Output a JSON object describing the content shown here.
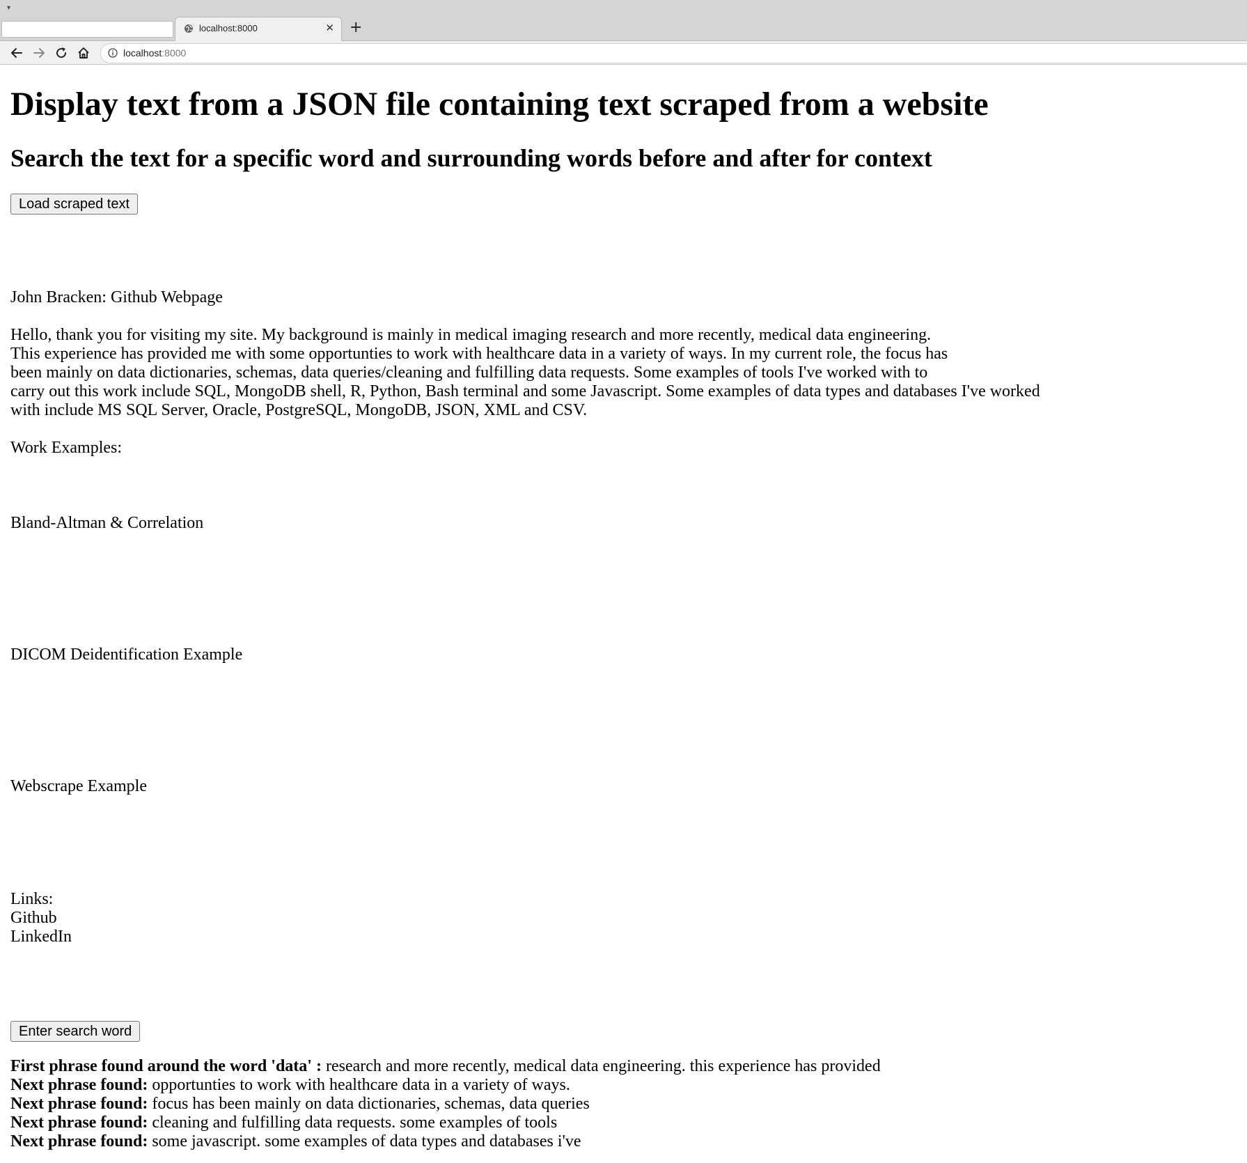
{
  "browser": {
    "tab_title": "localhost:8000",
    "new_tab_symbol": "+",
    "close_symbol": "✕",
    "url_host": "localhost",
    "url_port": ":8000"
  },
  "page": {
    "heading": "Display text from a JSON file containing text scraped from a website",
    "subheading": "Search the text for a specific word and surrounding words before and after for context",
    "load_button": "Load scraped text",
    "scraped": {
      "title": "John Bracken: Github Webpage",
      "intro_lines": [
        "Hello, thank you for visiting my site. My background is mainly in medical imaging research and more recently, medical data engineering.",
        "This experience has provided me with some opportunties to work with healthcare data in a variety of ways. In my current role, the focus has",
        "been mainly on data dictionaries, schemas, data queries/cleaning and fulfilling data requests. Some examples of tools I've worked with to",
        "carry out this work include SQL, MongoDB shell, R, Python, Bash terminal and some Javascript. Some examples of data types and databases I've worked",
        "with include MS SQL Server, Oracle, PostgreSQL, MongoDB, JSON, XML and CSV."
      ],
      "work_examples_label": "Work Examples:",
      "examples": [
        "Bland-Altman & Correlation",
        "DICOM Deidentification Example",
        "Webscrape Example"
      ],
      "links_label": "Links:",
      "links": [
        "Github",
        "LinkedIn"
      ]
    },
    "search_button": "Enter search word",
    "results": [
      {
        "label": "First phrase found around the word 'data' :",
        "text": " research and more recently, medical data engineering. this experience has provided"
      },
      {
        "label": "Next phrase found:",
        "text": " opportunties to work with healthcare data in a variety of ways."
      },
      {
        "label": "Next phrase found:",
        "text": " focus has been mainly on data dictionaries, schemas, data queries"
      },
      {
        "label": "Next phrase found:",
        "text": " cleaning and fulfilling data requests. some examples of tools"
      },
      {
        "label": "Next phrase found:",
        "text": " some javascript. some examples of data types and databases i've"
      }
    ]
  }
}
